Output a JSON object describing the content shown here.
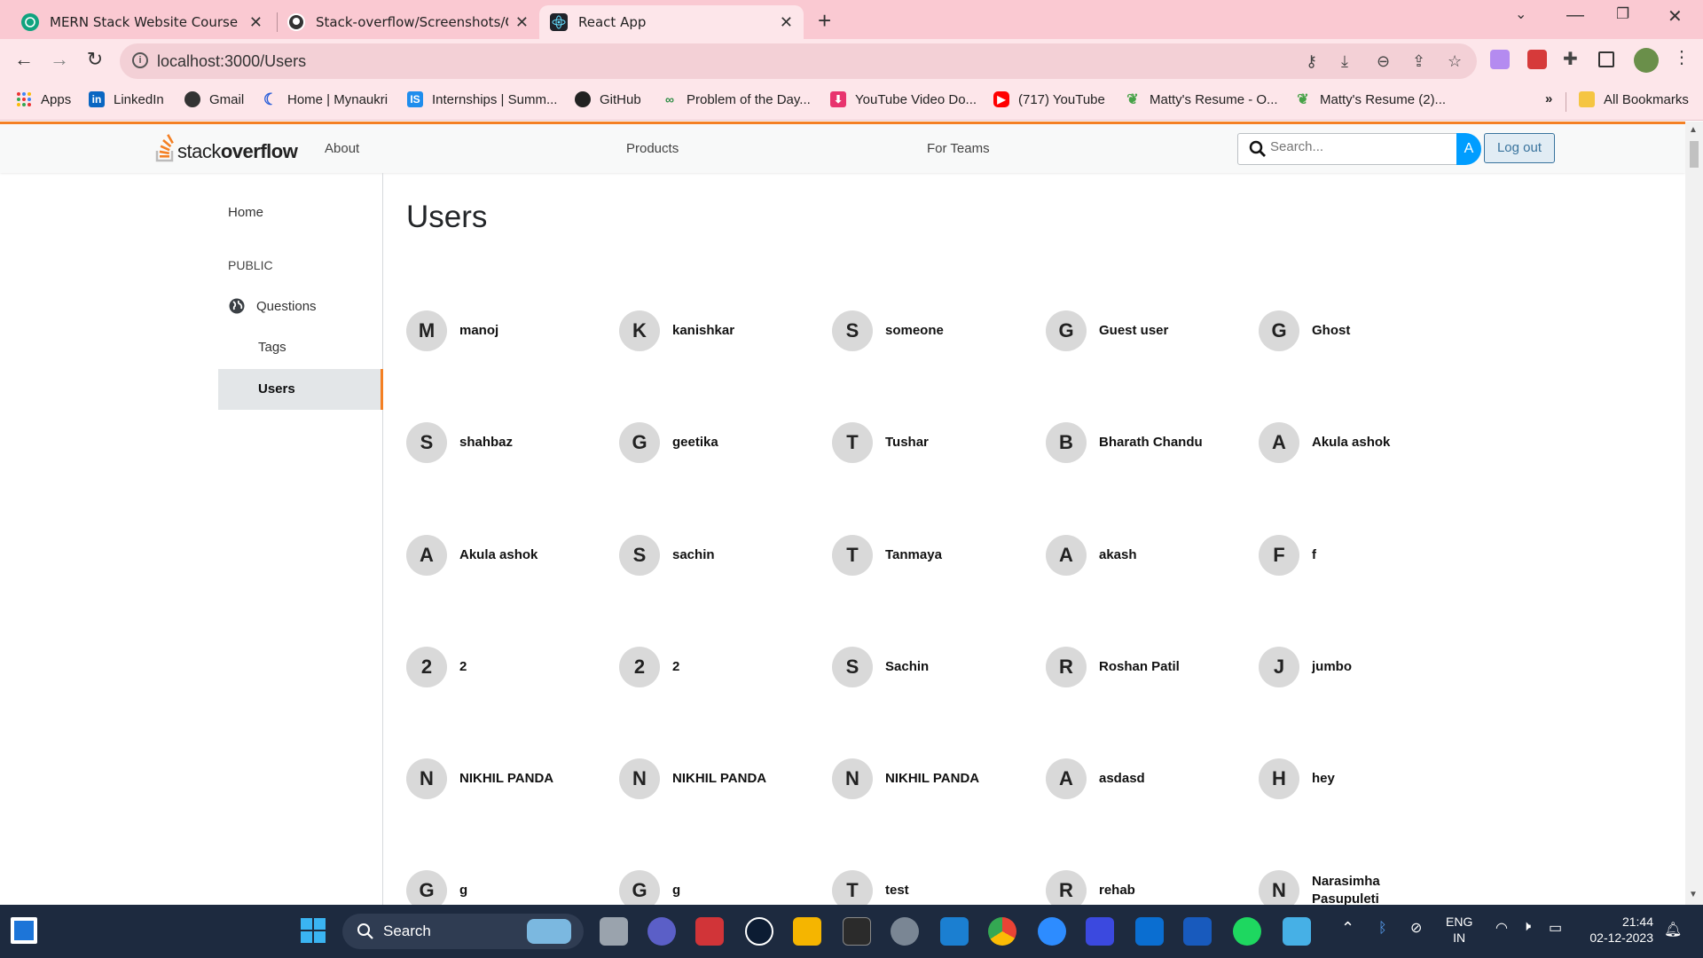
{
  "browser": {
    "tabs": [
      {
        "title": "MERN Stack Website Course",
        "active": false
      },
      {
        "title": "Stack-overflow/Screenshots/Que",
        "active": false
      },
      {
        "title": "React App",
        "active": true
      }
    ],
    "url": "localhost:3000/Users",
    "bookmarks": [
      {
        "label": "Apps",
        "icon": "apps-grid-icon"
      },
      {
        "label": "LinkedIn",
        "icon": "linkedin-icon"
      },
      {
        "label": "Gmail",
        "icon": "globe-icon"
      },
      {
        "label": "Home | Mynaukri",
        "icon": "mynaukri-icon"
      },
      {
        "label": "Internships | Summ...",
        "icon": "internshala-icon"
      },
      {
        "label": "GitHub",
        "icon": "github-icon"
      },
      {
        "label": "Problem of the Day...",
        "icon": "gfg-icon"
      },
      {
        "label": "YouTube Video Do...",
        "icon": "bookmark-icon"
      },
      {
        "label": "(717) YouTube",
        "icon": "youtube-icon"
      },
      {
        "label": "Matty's Resume - O...",
        "icon": "leaf-icon"
      },
      {
        "label": "Matty's Resume (2)...",
        "icon": "leaf-icon"
      }
    ],
    "bookmarks_overflow": "»",
    "all_bookmarks": "All Bookmarks"
  },
  "navbar": {
    "logo_light": "stack",
    "logo_bold": "overflow",
    "links": [
      "About",
      "Products",
      "For Teams"
    ],
    "search_placeholder": "Search...",
    "avatar_letter": "A",
    "logout_label": "Log out"
  },
  "sidebar": {
    "home": "Home",
    "public": "PUBLIC",
    "questions": "Questions",
    "tags": "Tags",
    "users": "Users"
  },
  "main": {
    "title": "Users",
    "users": [
      {
        "initial": "M",
        "name": "manoj"
      },
      {
        "initial": "K",
        "name": "kanishkar"
      },
      {
        "initial": "S",
        "name": "someone"
      },
      {
        "initial": "G",
        "name": "Guest user"
      },
      {
        "initial": "G",
        "name": "Ghost"
      },
      {
        "initial": "S",
        "name": "shahbaz"
      },
      {
        "initial": "G",
        "name": "geetika"
      },
      {
        "initial": "T",
        "name": "Tushar"
      },
      {
        "initial": "B",
        "name": "Bharath Chandu"
      },
      {
        "initial": "A",
        "name": "Akula ashok"
      },
      {
        "initial": "A",
        "name": "Akula ashok"
      },
      {
        "initial": "S",
        "name": "sachin"
      },
      {
        "initial": "T",
        "name": "Tanmaya"
      },
      {
        "initial": "A",
        "name": "akash"
      },
      {
        "initial": "F",
        "name": "f"
      },
      {
        "initial": "2",
        "name": "2"
      },
      {
        "initial": "2",
        "name": "2"
      },
      {
        "initial": "S",
        "name": "Sachin"
      },
      {
        "initial": "R",
        "name": "Roshan Patil"
      },
      {
        "initial": "J",
        "name": "jumbo"
      },
      {
        "initial": "N",
        "name": "NIKHIL PANDA"
      },
      {
        "initial": "N",
        "name": "NIKHIL PANDA"
      },
      {
        "initial": "N",
        "name": "NIKHIL PANDA"
      },
      {
        "initial": "A",
        "name": "asdasd"
      },
      {
        "initial": "H",
        "name": "hey"
      },
      {
        "initial": "G",
        "name": "g"
      },
      {
        "initial": "G",
        "name": "g"
      },
      {
        "initial": "T",
        "name": "test"
      },
      {
        "initial": "R",
        "name": "rehab"
      },
      {
        "initial": "N",
        "name": "Narasimha Pasupuleti"
      }
    ]
  },
  "taskbar": {
    "search_label": "Search",
    "lang_line1": "ENG",
    "lang_line2": "IN",
    "time": "21:44",
    "date": "02-12-2023"
  },
  "colors": {
    "tabstrip": "#fac9d2",
    "accent_orange": "#f48024",
    "logout_blue": "#39739d",
    "avatar_blue": "#009dff",
    "taskbar": "#1d2a3f"
  }
}
